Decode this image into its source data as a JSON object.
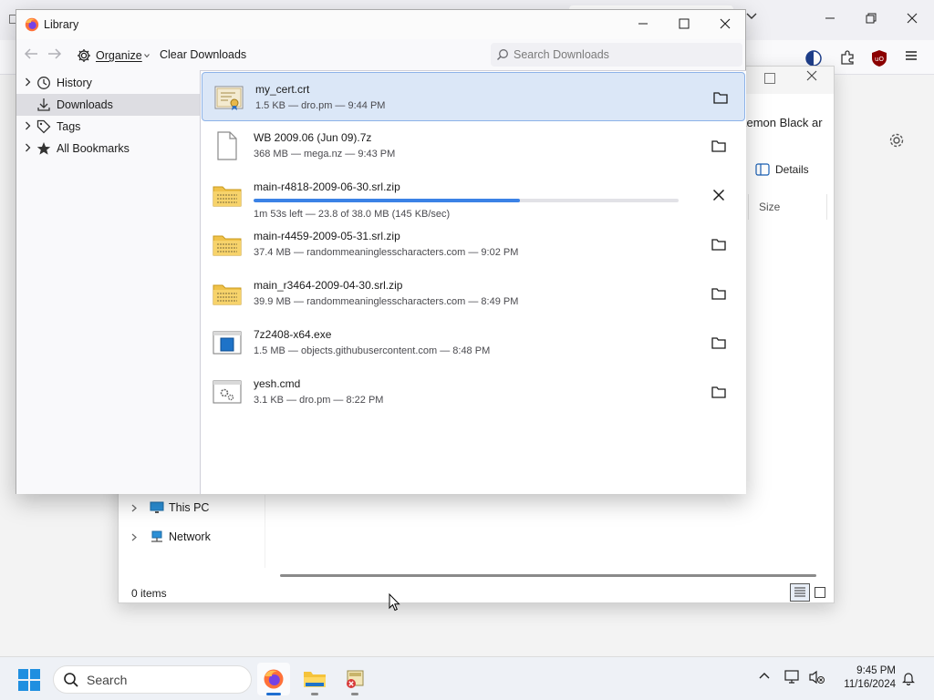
{
  "background": {
    "browser_partial_title": "kemon Black ar",
    "details_label": "Details",
    "column_size": "Size",
    "nav_items": [
      {
        "label": "This PC",
        "icon": "monitor-icon"
      },
      {
        "label": "Network",
        "icon": "network-icon"
      }
    ],
    "status_items": "0 items"
  },
  "library": {
    "title": "Library",
    "toolbar": {
      "organize_label": "Organize",
      "clear_label": "Clear Downloads",
      "search_placeholder": "Search Downloads"
    },
    "sidebar": [
      {
        "label": "History",
        "icon": "clock-icon",
        "expandable": true
      },
      {
        "label": "Downloads",
        "icon": "download-icon",
        "expandable": false,
        "selected": true
      },
      {
        "label": "Tags",
        "icon": "tag-icon",
        "expandable": true
      },
      {
        "label": "All Bookmarks",
        "icon": "star-icon",
        "expandable": true
      }
    ],
    "downloads": [
      {
        "name": "my_cert.crt",
        "status": "1.5 KB — dro.pm — 9:44 PM",
        "icon": "certificate-file-icon",
        "action": "show-in-folder",
        "selected": true
      },
      {
        "name": "WB 2009.06 (Jun 09).7z",
        "status": "368 MB — mega.nz — 9:43 PM",
        "icon": "generic-file-icon",
        "action": "show-in-folder"
      },
      {
        "name": "main-r4818-2009-06-30.srl.zip",
        "status": "1m 53s left — 23.8 of 38.0 MB (145 KB/sec)",
        "icon": "zip-folder-icon",
        "action": "cancel",
        "progress": 0.626
      },
      {
        "name": "main-r4459-2009-05-31.srl.zip",
        "status": "37.4 MB — randommeaninglesscharacters.com — 9:02 PM",
        "icon": "zip-folder-icon",
        "action": "show-in-folder"
      },
      {
        "name": "main_r3464-2009-04-30.srl.zip",
        "status": "39.9 MB — randommeaninglesscharacters.com — 8:49 PM",
        "icon": "zip-folder-icon",
        "action": "show-in-folder"
      },
      {
        "name": "7z2408-x64.exe",
        "status": "1.5 MB — objects.githubusercontent.com — 8:48 PM",
        "icon": "executable-file-icon",
        "action": "show-in-folder"
      },
      {
        "name": "yesh.cmd",
        "status": "3.1 KB — dro.pm — 8:22 PM",
        "icon": "script-file-icon",
        "action": "show-in-folder"
      }
    ]
  },
  "taskbar": {
    "search_label": "Search",
    "time": "9:45 PM",
    "date": "11/16/2024"
  },
  "colors": {
    "accent": "#3b82e6",
    "selected_row_bg": "#dbe7f7",
    "selected_row_border": "#8db3e8"
  }
}
